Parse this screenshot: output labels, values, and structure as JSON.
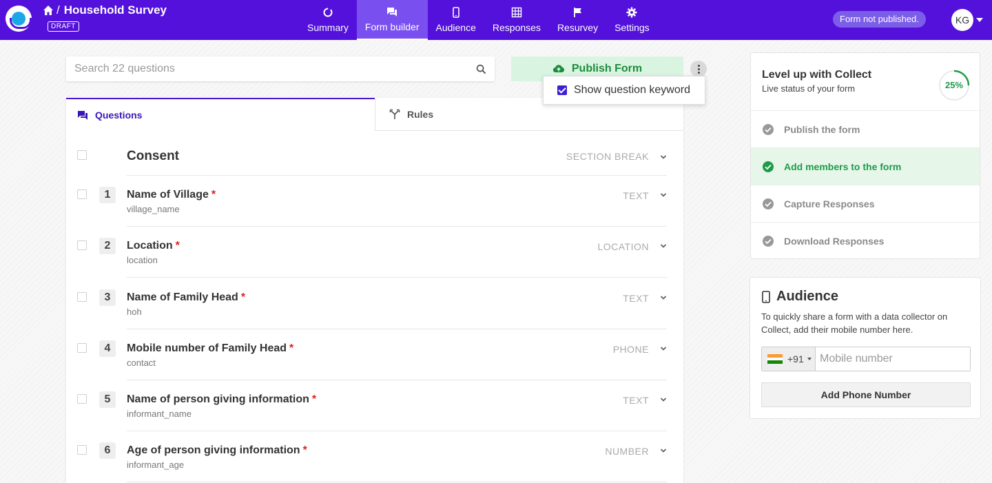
{
  "header": {
    "title": "Household Survey",
    "separator": "/",
    "draft_badge": "DRAFT",
    "nav": [
      {
        "label": "Summary",
        "icon": "summary-icon"
      },
      {
        "label": "Form builder",
        "icon": "form-builder-icon",
        "active": true
      },
      {
        "label": "Audience",
        "icon": "mobile-icon"
      },
      {
        "label": "Responses",
        "icon": "grid-icon"
      },
      {
        "label": "Resurvey",
        "icon": "flag-icon"
      },
      {
        "label": "Settings",
        "icon": "gear-icon"
      }
    ],
    "status_pill": "Form not published.",
    "avatar_initials": "KG",
    "brand_color": "#5411db"
  },
  "toolbar": {
    "search_placeholder": "Search 22 questions",
    "publish_label": "Publish Form",
    "menu_option": "Show question keyword",
    "menu_option_checked": true
  },
  "tabs": [
    {
      "label": "Questions",
      "icon": "questions-icon",
      "active": true
    },
    {
      "label": "Rules",
      "icon": "rules-icon"
    }
  ],
  "section": {
    "title": "Consent",
    "type": "SECTION BREAK"
  },
  "questions": [
    {
      "number": "1",
      "title": "Name of Village",
      "required": "*",
      "keyword": "village_name",
      "type": "TEXT"
    },
    {
      "number": "2",
      "title": "Location",
      "required": "*",
      "keyword": "location",
      "type": "LOCATION"
    },
    {
      "number": "3",
      "title": "Name of Family Head",
      "required": "*",
      "keyword": "hoh",
      "type": "TEXT"
    },
    {
      "number": "4",
      "title": "Mobile number of Family Head",
      "required": "*",
      "keyword": "contact",
      "type": "PHONE"
    },
    {
      "number": "5",
      "title": "Name of person giving information",
      "required": "*",
      "keyword": "informant_name",
      "type": "TEXT"
    },
    {
      "number": "6",
      "title": "Age of person giving information",
      "required": "*",
      "keyword": "informant_age",
      "type": "NUMBER"
    }
  ],
  "level_up": {
    "title": "Level up with Collect",
    "subtitle": "Live status of your form",
    "progress_label": "25%",
    "progress_fraction": 0.25,
    "steps": [
      {
        "label": "Publish the form",
        "done": false
      },
      {
        "label": "Add members to the form",
        "done": true
      },
      {
        "label": "Capture Responses",
        "done": false
      },
      {
        "label": "Download Responses",
        "done": false
      }
    ]
  },
  "audience": {
    "title": "Audience",
    "description": "To quickly share a form with a data collector on Collect, add their mobile number here.",
    "country_code": "+91",
    "phone_placeholder": "Mobile number",
    "add_button": "Add Phone Number"
  }
}
